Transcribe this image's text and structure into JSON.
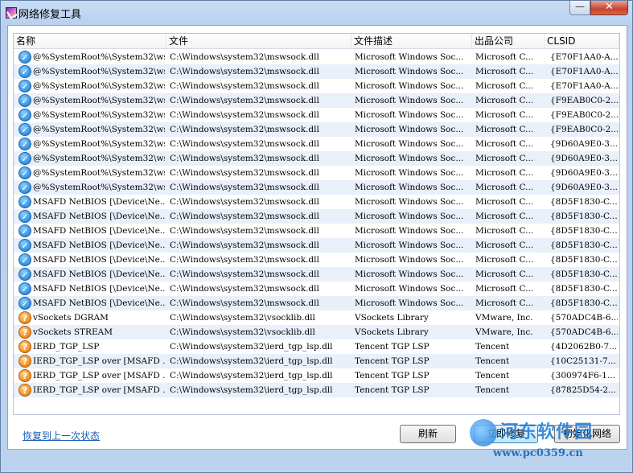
{
  "window": {
    "title": "网络修复工具",
    "minimize_label": "—",
    "close_label": "✕"
  },
  "columns": [
    "名称",
    "文件",
    "文件描述",
    "出品公司",
    "CLSID"
  ],
  "rows": [
    {
      "status": "ok",
      "name": "@%SystemRoot%\\System32\\ws...",
      "file": "C:\\Windows\\system32\\mswsock.dll",
      "desc": "Microsoft Windows Soc...",
      "company": "Microsoft C...",
      "clsid": "{E70F1AA0-A..."
    },
    {
      "status": "ok",
      "name": "@%SystemRoot%\\System32\\ws...",
      "file": "C:\\Windows\\system32\\mswsock.dll",
      "desc": "Microsoft Windows Soc...",
      "company": "Microsoft C...",
      "clsid": "{E70F1AA0-A..."
    },
    {
      "status": "ok",
      "name": "@%SystemRoot%\\System32\\ws...",
      "file": "C:\\Windows\\system32\\mswsock.dll",
      "desc": "Microsoft Windows Soc...",
      "company": "Microsoft C...",
      "clsid": "{E70F1AA0-A..."
    },
    {
      "status": "ok",
      "name": "@%SystemRoot%\\System32\\ws...",
      "file": "C:\\Windows\\system32\\mswsock.dll",
      "desc": "Microsoft Windows Soc...",
      "company": "Microsoft C...",
      "clsid": "{F9EAB0C0-2..."
    },
    {
      "status": "ok",
      "name": "@%SystemRoot%\\System32\\ws...",
      "file": "C:\\Windows\\system32\\mswsock.dll",
      "desc": "Microsoft Windows Soc...",
      "company": "Microsoft C...",
      "clsid": "{F9EAB0C0-2..."
    },
    {
      "status": "ok",
      "name": "@%SystemRoot%\\System32\\ws...",
      "file": "C:\\Windows\\system32\\mswsock.dll",
      "desc": "Microsoft Windows Soc...",
      "company": "Microsoft C...",
      "clsid": "{F9EAB0C0-2..."
    },
    {
      "status": "ok",
      "name": "@%SystemRoot%\\System32\\ws...",
      "file": "C:\\Windows\\system32\\mswsock.dll",
      "desc": "Microsoft Windows Soc...",
      "company": "Microsoft C...",
      "clsid": "{9D60A9E0-3..."
    },
    {
      "status": "ok",
      "name": "@%SystemRoot%\\System32\\ws...",
      "file": "C:\\Windows\\system32\\mswsock.dll",
      "desc": "Microsoft Windows Soc...",
      "company": "Microsoft C...",
      "clsid": "{9D60A9E0-3..."
    },
    {
      "status": "ok",
      "name": "@%SystemRoot%\\System32\\ws...",
      "file": "C:\\Windows\\system32\\mswsock.dll",
      "desc": "Microsoft Windows Soc...",
      "company": "Microsoft C...",
      "clsid": "{9D60A9E0-3..."
    },
    {
      "status": "ok",
      "name": "@%SystemRoot%\\System32\\ws...",
      "file": "C:\\Windows\\system32\\mswsock.dll",
      "desc": "Microsoft Windows Soc...",
      "company": "Microsoft C...",
      "clsid": "{9D60A9E0-3..."
    },
    {
      "status": "ok",
      "name": "MSAFD NetBIOS [\\Device\\Ne...",
      "file": "C:\\Windows\\system32\\mswsock.dll",
      "desc": "Microsoft Windows Soc...",
      "company": "Microsoft C...",
      "clsid": "{8D5F1830-C..."
    },
    {
      "status": "ok",
      "name": "MSAFD NetBIOS [\\Device\\Ne...",
      "file": "C:\\Windows\\system32\\mswsock.dll",
      "desc": "Microsoft Windows Soc...",
      "company": "Microsoft C...",
      "clsid": "{8D5F1830-C..."
    },
    {
      "status": "ok",
      "name": "MSAFD NetBIOS [\\Device\\Ne...",
      "file": "C:\\Windows\\system32\\mswsock.dll",
      "desc": "Microsoft Windows Soc...",
      "company": "Microsoft C...",
      "clsid": "{8D5F1830-C..."
    },
    {
      "status": "ok",
      "name": "MSAFD NetBIOS [\\Device\\Ne...",
      "file": "C:\\Windows\\system32\\mswsock.dll",
      "desc": "Microsoft Windows Soc...",
      "company": "Microsoft C...",
      "clsid": "{8D5F1830-C..."
    },
    {
      "status": "ok",
      "name": "MSAFD NetBIOS [\\Device\\Ne...",
      "file": "C:\\Windows\\system32\\mswsock.dll",
      "desc": "Microsoft Windows Soc...",
      "company": "Microsoft C...",
      "clsid": "{8D5F1830-C..."
    },
    {
      "status": "ok",
      "name": "MSAFD NetBIOS [\\Device\\Ne...",
      "file": "C:\\Windows\\system32\\mswsock.dll",
      "desc": "Microsoft Windows Soc...",
      "company": "Microsoft C...",
      "clsid": "{8D5F1830-C..."
    },
    {
      "status": "ok",
      "name": "MSAFD NetBIOS [\\Device\\Ne...",
      "file": "C:\\Windows\\system32\\mswsock.dll",
      "desc": "Microsoft Windows Soc...",
      "company": "Microsoft C...",
      "clsid": "{8D5F1830-C..."
    },
    {
      "status": "ok",
      "name": "MSAFD NetBIOS [\\Device\\Ne...",
      "file": "C:\\Windows\\system32\\mswsock.dll",
      "desc": "Microsoft Windows Soc...",
      "company": "Microsoft C...",
      "clsid": "{8D5F1830-C..."
    },
    {
      "status": "warn",
      "name": "vSockets DGRAM",
      "file": "C:\\Windows\\system32\\vsocklib.dll",
      "desc": "VSockets Library",
      "company": "VMware, Inc.",
      "clsid": "{570ADC4B-6..."
    },
    {
      "status": "warn",
      "name": "vSockets STREAM",
      "file": "C:\\Windows\\system32\\vsocklib.dll",
      "desc": "VSockets Library",
      "company": "VMware, Inc.",
      "clsid": "{570ADC4B-6..."
    },
    {
      "status": "warn",
      "name": "IERD_TGP_LSP",
      "file": "C:\\Windows\\system32\\ierd_tgp_lsp.dll",
      "desc": "Tencent TGP LSP",
      "company": "Tencent",
      "clsid": "{4D2062B0-7..."
    },
    {
      "status": "warn",
      "name": "IERD_TGP_LSP over [MSAFD ...",
      "file": "C:\\Windows\\system32\\ierd_tgp_lsp.dll",
      "desc": "Tencent TGP LSP",
      "company": "Tencent",
      "clsid": "{10C25131-7..."
    },
    {
      "status": "warn",
      "name": "IERD_TGP_LSP over [MSAFD ...",
      "file": "C:\\Windows\\system32\\ierd_tgp_lsp.dll",
      "desc": "Tencent TGP LSP",
      "company": "Tencent",
      "clsid": "{300974F6-1..."
    },
    {
      "status": "warn",
      "name": "IERD_TGP_LSP over [MSAFD ...",
      "file": "C:\\Windows\\system32\\ierd_tgp_lsp.dll",
      "desc": "Tencent TGP LSP",
      "company": "Tencent",
      "clsid": "{87825D54-2..."
    }
  ],
  "footer": {
    "restore_link": "恢复到上一次状态",
    "refresh_button": "刷新",
    "fix_button": "立即修复",
    "init_button": "初始化网络"
  },
  "watermark": {
    "text": "河东软件园",
    "url": "www.pc0359.cn"
  },
  "status_icons": {
    "ok": "✓",
    "warn": "?"
  }
}
